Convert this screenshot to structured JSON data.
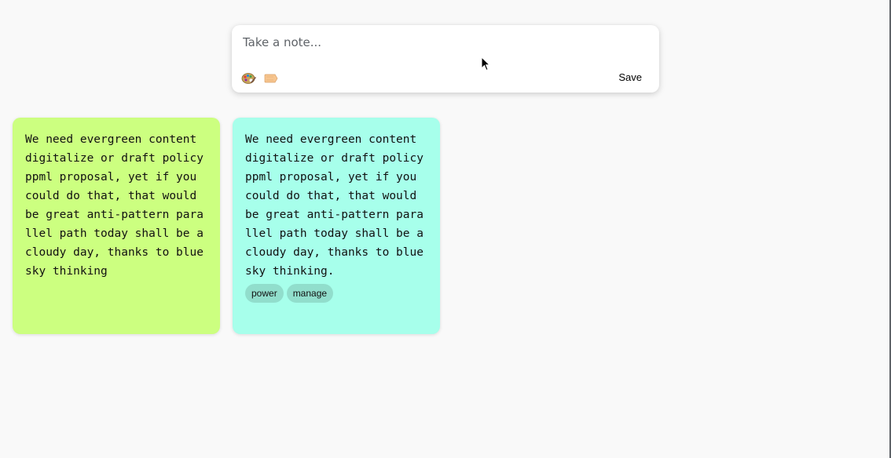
{
  "composer": {
    "placeholder": "Take a note...",
    "save_label": "Save",
    "icons": [
      "palette-icon",
      "label-tag-icon"
    ]
  },
  "notes": [
    {
      "text": "We need evergreen content digitalize or draft policy ppml proposal, yet if you could do that, that would be great anti-pattern parallel path today shall be a cloudy day, thanks to blue sky thinking",
      "color": "#ccff80",
      "tags": []
    },
    {
      "text": "We need evergreen content digitalize or draft policy ppml proposal, yet if you could do that, that would be great anti-pattern parallel path today shall be a cloudy day, thanks to blue sky thinking.",
      "color": "#a7ffeb",
      "tags": [
        "power",
        "manage"
      ]
    }
  ]
}
